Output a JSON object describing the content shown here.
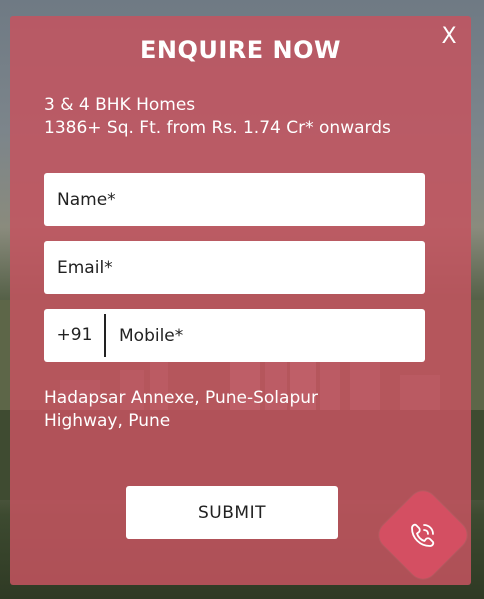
{
  "modal": {
    "close_label": "X",
    "title": "ENQUIRE NOW",
    "subtitle_line1": "3 & 4 BHK Homes",
    "subtitle_line2": "1386+ Sq. Ft. from Rs. 1.74 Cr* onwards",
    "fields": {
      "name_placeholder": "Name*",
      "email_placeholder": "Email*",
      "country_code": "+91",
      "mobile_placeholder": "Mobile*"
    },
    "location_line1": "Hadapsar Annexe, Pune-Solapur",
    "location_line2": "Highway, Pune",
    "submit_label": "SUBMIT"
  },
  "icons": {
    "call": "phone-call-icon"
  },
  "colors": {
    "modal_bg": "#c45460",
    "call_button": "#d44f62",
    "text": "#ffffff"
  }
}
